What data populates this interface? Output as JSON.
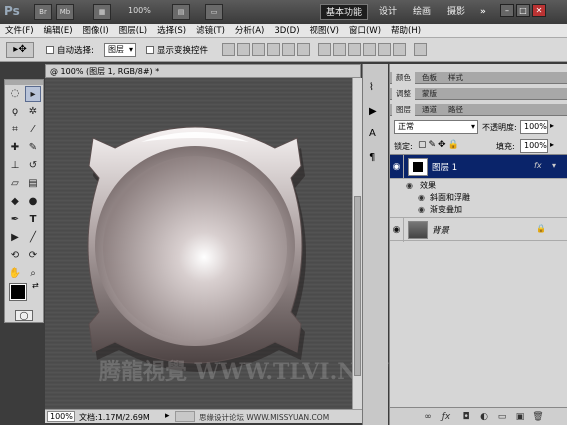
{
  "app": {
    "logo": "Ps",
    "icon_br": "Br",
    "icon_mb": "Mb",
    "zoom": "100%",
    "workspaces": [
      "基本功能",
      "设计",
      "绘画",
      "摄影"
    ],
    "more": "»"
  },
  "menu": [
    "文件(F)",
    "编辑(E)",
    "图像(I)",
    "图层(L)",
    "选择(S)",
    "滤镜(T)",
    "分析(A)",
    "3D(D)",
    "视图(V)",
    "窗口(W)",
    "帮助(H)"
  ],
  "options": {
    "auto_select_label": "自动选择:",
    "auto_select_value": "图层",
    "show_transform_label": "显示变换控件"
  },
  "document": {
    "tab_title": "@ 100% (图层 1, RGB/8#) *",
    "zoom_field": "100%",
    "doc_info": "文档:1.17M/2.69M"
  },
  "watermark": {
    "text": "腾龍視覺 WWW.TLVI.NET",
    "bottom_credit": "思缘设计论坛 WWW.MISSYUAN.COM"
  },
  "panels": {
    "row1_tabs": [
      "颜色",
      "色板",
      "样式"
    ],
    "row2_tabs": [
      "调整",
      "蒙版"
    ],
    "row3_tabs": [
      "图层",
      "通道",
      "路径"
    ],
    "blend_mode": "正常",
    "opacity_label": "不透明度:",
    "opacity_value": "100%",
    "lock_label": "锁定:",
    "fill_label": "填充:",
    "fill_value": "100%",
    "layers": [
      {
        "name": "图层 1",
        "selected": true,
        "fx": "fx"
      },
      {
        "name": "背景",
        "selected": false
      }
    ],
    "effects_label": "效果",
    "effects": [
      "斜面和浮雕",
      "渐变叠加"
    ]
  },
  "colors": {
    "accent_selected": "#0a246a",
    "workspace_active": "#1d1d1d"
  }
}
